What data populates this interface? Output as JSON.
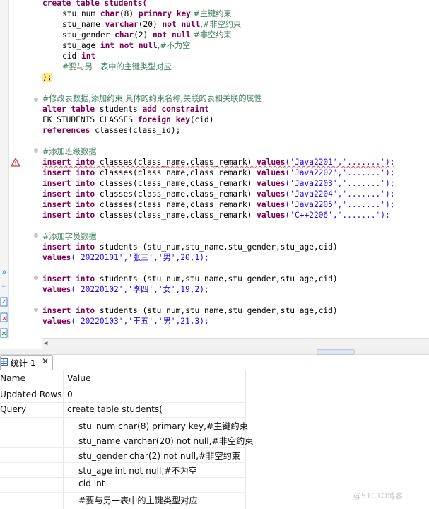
{
  "editor": {
    "lines": {
      "l1a": "create table students(",
      "l2a": "stu_num",
      "l2b": "char",
      "l2c": "(8)",
      "l2d": "primary key",
      "l2e": ",#主键约束",
      "l3a": "stu_name",
      "l3b": "varchar",
      "l3c": "(20)",
      "l3d": "not null",
      "l3e": ",#非空约束",
      "l4a": "stu_gender",
      "l4b": "char",
      "l4c": "(2)",
      "l4d": "not null",
      "l4e": ",#非空约束",
      "l5a": "stu_age",
      "l5b": "int",
      "l5d": "not null",
      "l5e": ",#不为空",
      "l6a": "cid",
      "l6b": "int",
      "l7": "#要与另一表中的主键类型对应",
      "l8": ");",
      "c1": "#修改表数据,添加约束,具体的约束名称,关联的表和关联的属性",
      "a1": "alter table",
      "a1b": " students ",
      "a1c": "add constraint",
      "a2": "FK_STUDENTS_CLASSES ",
      "a2b": "foreign key",
      "a2c": "(cid)",
      "a3": "references",
      "a3b": " classes(class_id);",
      "c2": "#添加班级数据",
      "ins": "insert into",
      "cls": " classes(class_name,class_remark) ",
      "vals": "values",
      "v1": "('Java2201','.......');",
      "v2": "('Java2202','.......');",
      "v3": "('Java2203','.......');",
      "v4": "('Java2204','.......');",
      "v5": "('Java2205','.......');",
      "v6": "('C++2206','.......');",
      "c3": "#添加学员数据",
      "stu": " students (stu_num,stu_name,stu_gender,stu_age,cid)",
      "s1a": "('20220101','",
      "s1b": "张三",
      "s1c": "','",
      "s1d": "男",
      "s1e": "',20,1);",
      "s2a": "('20220102','",
      "s2b": "李四",
      "s2c": "','",
      "s2d": "女",
      "s2e": "',19,2);",
      "s3a": "('20220103','",
      "s3b": "王五",
      "s3c": "','",
      "s3d": "男",
      "s3e": "',21,3);"
    }
  },
  "results_tab": {
    "label": "统计 1",
    "close": "✕"
  },
  "results": {
    "header": {
      "name": "Name",
      "value": "Value"
    },
    "rows": [
      {
        "name": "Updated Rows",
        "value": "0"
      },
      {
        "name": "Query",
        "value": "create table students("
      },
      {
        "name": "",
        "value": "stu_num char(8) primary key,#主键约束"
      },
      {
        "name": "",
        "value": "stu_name varchar(20) not null,#非空约束"
      },
      {
        "name": "",
        "value": "stu_gender char(2) not null,#非空约束"
      },
      {
        "name": "",
        "value": "stu_age int not null,#不为空"
      },
      {
        "name": "",
        "value": "cid int"
      },
      {
        "name": "",
        "value": "#要与另一表中的主键类型对应"
      }
    ]
  },
  "watermark": "@51CTO博客",
  "colors": {
    "keyword": "#7f0055",
    "string": "#2a00ff",
    "comment": "#3f7f5f",
    "number": "#098658",
    "error_underline": "#e05050"
  }
}
